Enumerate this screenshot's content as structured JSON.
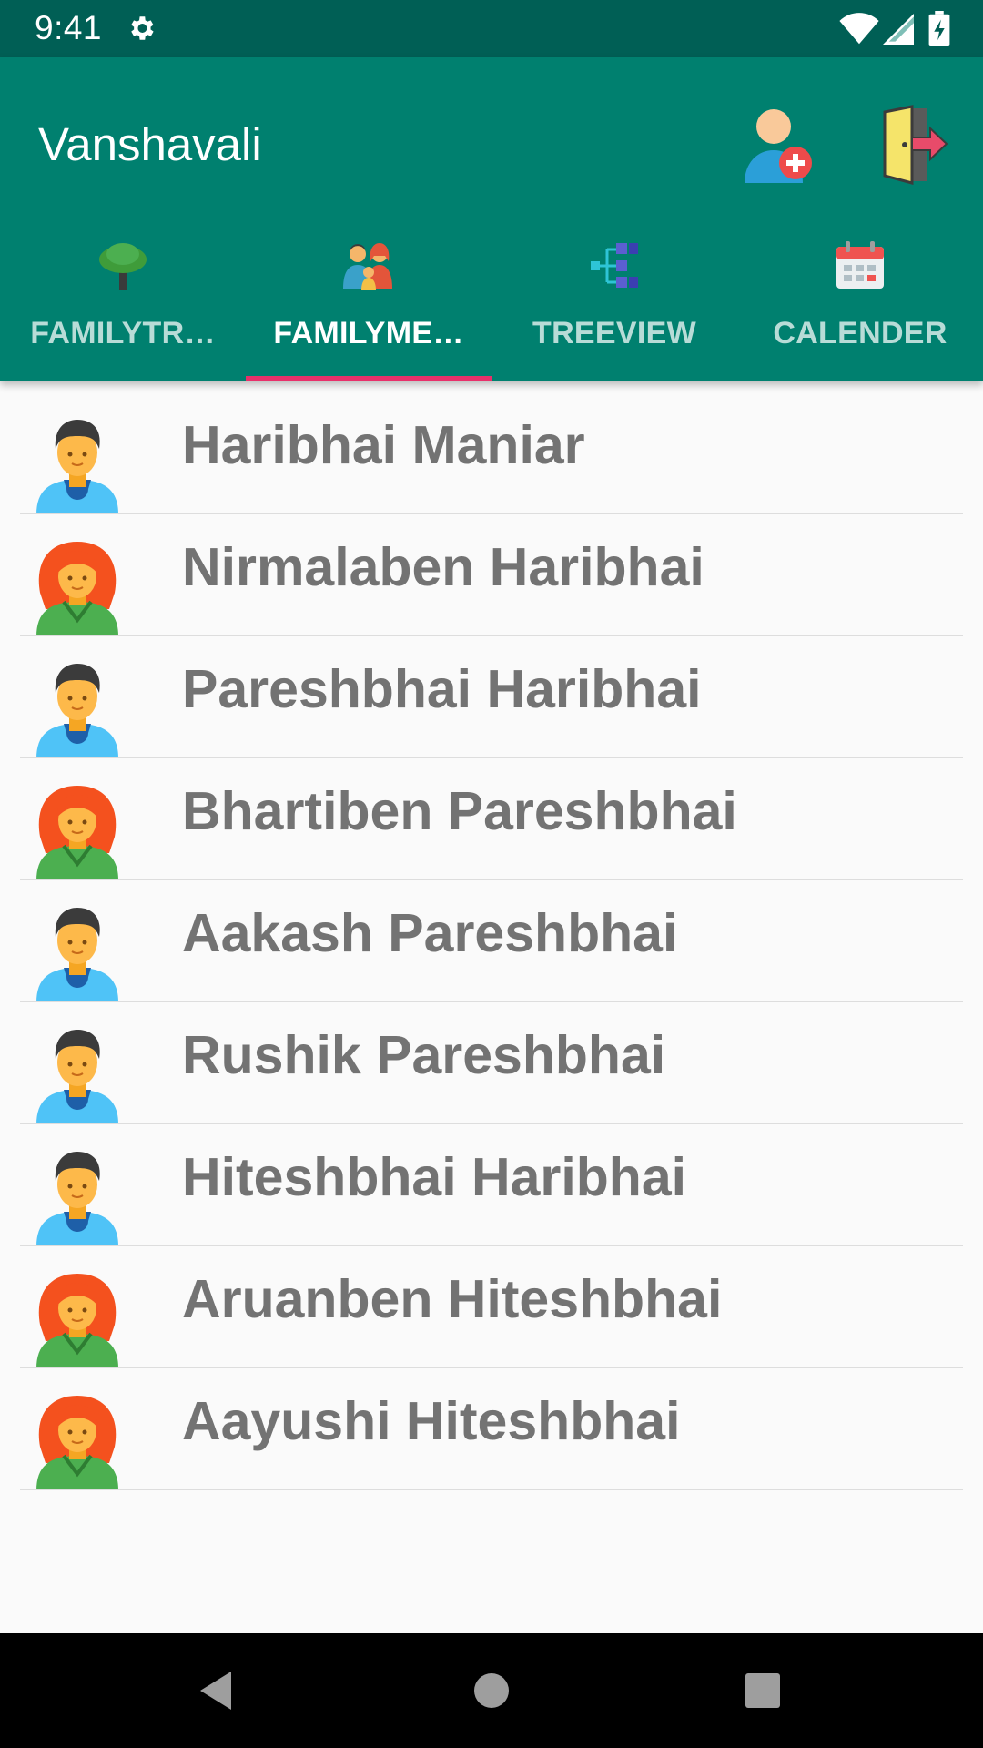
{
  "status_bar": {
    "time": "9:41",
    "icons": [
      "gear-icon",
      "wifi-icon",
      "signal-icon",
      "battery-icon"
    ]
  },
  "app_bar": {
    "title": "Vanshavali",
    "actions": [
      "add-member-icon",
      "logout-door-icon"
    ],
    "color": "#00806f"
  },
  "tabs": [
    {
      "label": "FAMILYTR…",
      "icon": "tree-icon",
      "active": false
    },
    {
      "label": "FAMILYME…",
      "icon": "family-icon",
      "active": true
    },
    {
      "label": "TREEVIEW",
      "icon": "tree-diagram-icon",
      "active": false
    },
    {
      "label": "CALENDER",
      "icon": "calendar-icon",
      "active": false
    }
  ],
  "accent_color": "#e8306a",
  "members": [
    {
      "name": "Haribhai Maniar",
      "gender": "male"
    },
    {
      "name": "Nirmalaben Haribhai",
      "gender": "female"
    },
    {
      "name": "Pareshbhai Haribhai",
      "gender": "male"
    },
    {
      "name": "Bhartiben Pareshbhai",
      "gender": "female"
    },
    {
      "name": "Aakash Pareshbhai",
      "gender": "male"
    },
    {
      "name": "Rushik Pareshbhai",
      "gender": "male"
    },
    {
      "name": "Hiteshbhai Haribhai",
      "gender": "male"
    },
    {
      "name": "Aruanben Hiteshbhai",
      "gender": "female"
    },
    {
      "name": "Aayushi Hiteshbhai",
      "gender": "female"
    }
  ],
  "nav_bar": {
    "buttons": [
      "back-icon",
      "home-icon",
      "recents-icon"
    ]
  }
}
